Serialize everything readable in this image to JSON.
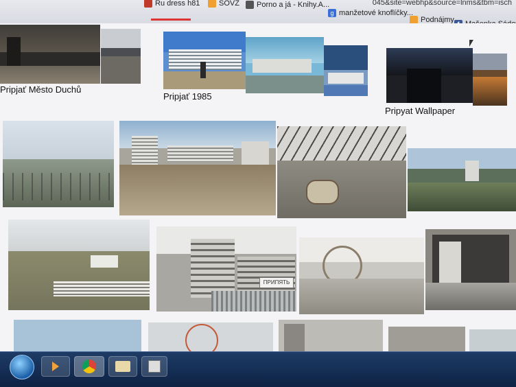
{
  "browser": {
    "url_fragment": "045&site=webhp&source=lnms&tbm=isch",
    "bookmarks": [
      {
        "label": "Ru dress h81",
        "icon": "bookmark-icon",
        "color": "#c0392b"
      },
      {
        "label": "SOVZ",
        "icon": "folder-icon",
        "color": "#f0a030"
      },
      {
        "label": "Porno a já - Knihy.A...",
        "icon": "page-icon",
        "color": "#555555"
      },
      {
        "label": "manžetové knoflíčky...",
        "icon": "google-icon",
        "color": "#3a6fd8"
      },
      {
        "label": "Podnájmy",
        "icon": "folder-icon",
        "color": "#f0a030"
      },
      {
        "label": "Mašenka Sádovsk...",
        "icon": "facebook-icon",
        "color": "#3b5998"
      }
    ]
  },
  "related_searches": [
    {
      "label": "Pripjať Město Duchů"
    },
    {
      "label": "Pripjať 1985"
    },
    {
      "label": "Pripyat Wallpaper"
    }
  ],
  "image_grid": {
    "row1_count": 4,
    "row2_count": 4,
    "row3_count": 5,
    "sign_text": "ПРИПЯТЬ"
  },
  "taskbar": {
    "items": [
      {
        "name": "start-button",
        "icon": "windows-logo-icon"
      },
      {
        "name": "media-player",
        "icon": "play-icon"
      },
      {
        "name": "chrome",
        "icon": "chrome-icon"
      },
      {
        "name": "file-explorer",
        "icon": "folder-icon"
      },
      {
        "name": "app-window",
        "icon": "window-icon"
      }
    ]
  },
  "colors": {
    "taskbar": "#1e3c66",
    "page_bg": "#f4f4f6",
    "tab_accent": "#dd3333"
  }
}
